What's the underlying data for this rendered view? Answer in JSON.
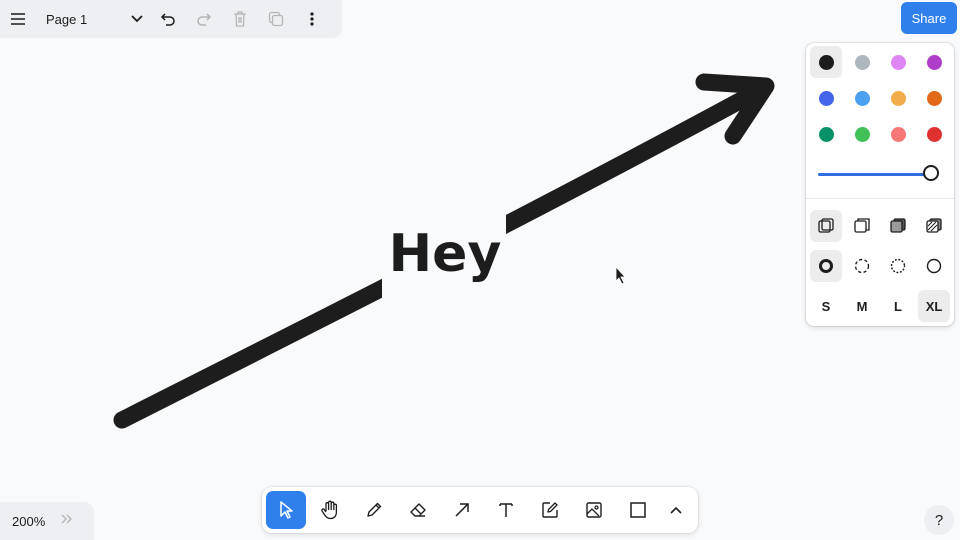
{
  "menu": {
    "page_name": "Page 1"
  },
  "share_label": "Share",
  "canvas": {
    "text_shape": "Hey",
    "arrow_color": "#1d1d1d"
  },
  "style_panel": {
    "colors": [
      {
        "name": "black",
        "hex": "#1d1d1d",
        "selected": true
      },
      {
        "name": "grey",
        "hex": "#adb5bd"
      },
      {
        "name": "light-violet",
        "hex": "#e085f4"
      },
      {
        "name": "violet",
        "hex": "#ae3ec9"
      },
      {
        "name": "blue",
        "hex": "#4465e9"
      },
      {
        "name": "light-blue",
        "hex": "#4ba1f1"
      },
      {
        "name": "yellow",
        "hex": "#f1ac4b"
      },
      {
        "name": "orange",
        "hex": "#e16919"
      },
      {
        "name": "green",
        "hex": "#099268"
      },
      {
        "name": "light-green",
        "hex": "#40c057"
      },
      {
        "name": "light-red",
        "hex": "#f87777"
      },
      {
        "name": "red",
        "hex": "#e03131"
      }
    ],
    "opacity": 1,
    "fill_options": [
      "fill-none-icon",
      "fill-semi-icon",
      "fill-solid-icon",
      "fill-pattern-icon"
    ],
    "dash_options": [
      "dash-draw-icon",
      "dash-dashed-icon",
      "dash-dotted-icon",
      "dash-solid-icon"
    ],
    "sizes": [
      "S",
      "M",
      "L",
      "XL"
    ],
    "selected_size": "XL",
    "selected_fill": "fill-none-icon",
    "selected_dash": "dash-draw-icon"
  },
  "toolbar": {
    "tools": [
      "select-tool-icon",
      "hand-tool-icon",
      "draw-tool-icon",
      "eraser-tool-icon",
      "arrow-tool-icon",
      "text-tool-icon",
      "note-tool-icon",
      "image-tool-icon",
      "rectangle-tool-icon",
      "more-tools-icon"
    ],
    "active_tool": "select-tool-icon"
  },
  "zoom": {
    "level": "200%"
  },
  "help_label": "?"
}
